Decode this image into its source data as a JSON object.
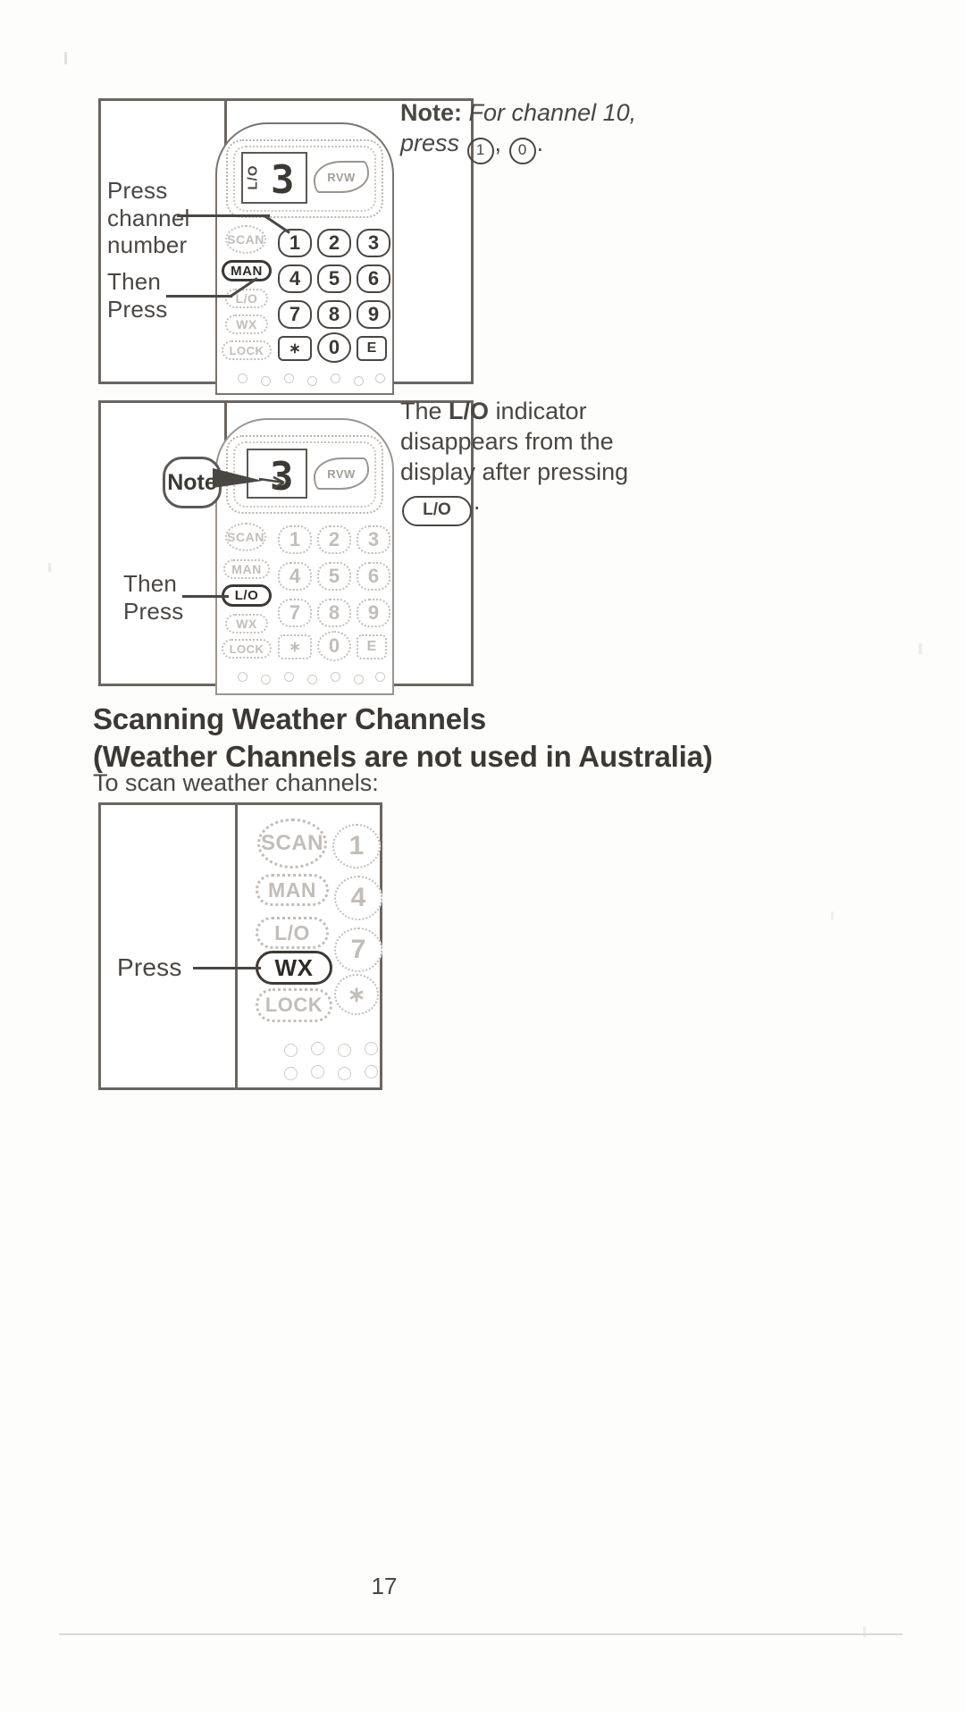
{
  "page": {
    "number": "17"
  },
  "panels": [
    {
      "id": "panel-channel-entry",
      "captions": {
        "press_channel_number": "Press\nchannel\nnumber",
        "then_press": "Then\nPress"
      },
      "display": {
        "lo_indicator": "L/O",
        "channel_digit": "3",
        "rvw_label": "RVW"
      },
      "function_keys": [
        "SCAN",
        "MAN",
        "L/O",
        "WX",
        "LOCK"
      ],
      "highlighted_key": "MAN",
      "number_keys": [
        "1",
        "2",
        "3",
        "4",
        "5",
        "6",
        "7",
        "8",
        "9",
        "∗",
        "0",
        "E"
      ]
    },
    {
      "id": "panel-lockout-clear",
      "captions": {
        "note_bubble": "Note",
        "then_press": "Then\nPress"
      },
      "display": {
        "channel_digit": "3",
        "rvw_label": "RVW"
      },
      "function_keys": [
        "SCAN",
        "MAN",
        "L/O",
        "WX",
        "LOCK"
      ],
      "highlighted_key": "L/O",
      "number_keys": [
        "1",
        "2",
        "3",
        "4",
        "5",
        "6",
        "7",
        "8",
        "9",
        "∗",
        "0",
        "E"
      ]
    },
    {
      "id": "panel-weather-scan",
      "captions": {
        "press": "Press"
      },
      "function_keys": [
        "SCAN",
        "MAN",
        "L/O",
        "WX",
        "LOCK"
      ],
      "highlighted_key": "WX",
      "number_keys": [
        "1",
        "4",
        "7",
        "∗"
      ]
    }
  ],
  "text_blocks": {
    "note_channel10": {
      "label": "Note:",
      "line1": "For channel 10,",
      "line2_prefix": "press",
      "key1": "1",
      "separator": ",",
      "key2": "0",
      "terminator": "."
    },
    "lo_indicator_note": {
      "line1_prefix": "The",
      "line1_bold": "L/O",
      "line1_suffix": "indicator",
      "line2": "disappears from the",
      "line3": "display after pressing",
      "key_label": "L/O",
      "terminator": "."
    }
  },
  "section": {
    "heading_line1": "Scanning Weather Channels",
    "heading_line2": "(Weather Channels are not used in Australia)",
    "intro": "To scan weather channels:"
  },
  "colors": {
    "ink": "#4a4642",
    "ink_dark": "#3c3834",
    "faint": "#c3bdb7",
    "rule": "#ddd8d3",
    "paper": "#fdfdfc"
  }
}
